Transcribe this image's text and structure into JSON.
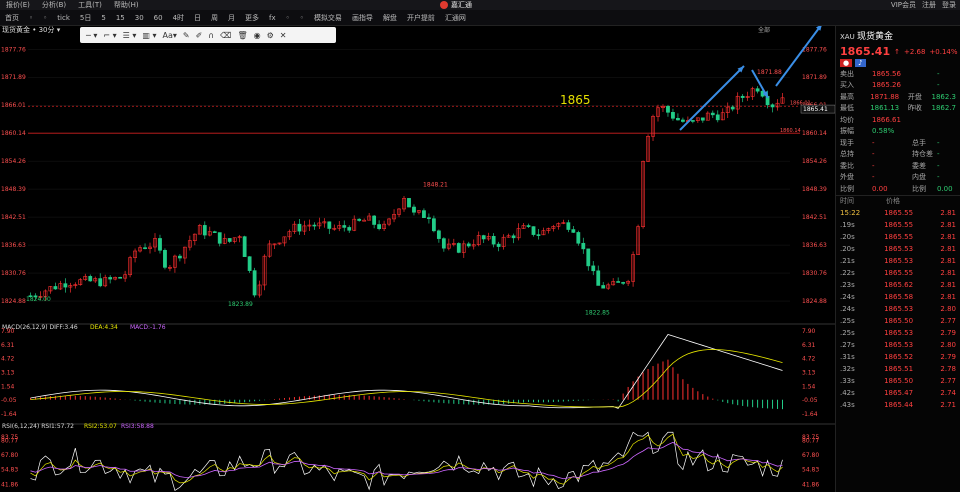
{
  "menu": {
    "items": [
      "报价(E)",
      "分析(B)",
      "工具(T)",
      "帮助(H)"
    ],
    "brand": "嘉汇通",
    "right": [
      "VIP会员",
      "注册",
      "登录"
    ]
  },
  "toolbar": {
    "items": [
      "首页",
      "",
      "",
      "tick",
      "5日",
      "5",
      "15",
      "30",
      "60",
      "4时",
      "日",
      "周",
      "月",
      "更多",
      "fx",
      "",
      "",
      "模拟交易",
      "画指导",
      "解盘",
      "开户提前",
      "汇通网"
    ]
  },
  "chart": {
    "title": "现货黄金 • 30分 ▾",
    "level_label": "1865",
    "restore_btn": "全部",
    "price_ticks": [
      1877.76,
      1871.89,
      1866.01,
      1860.14,
      1854.26,
      1848.39,
      1842.51,
      1836.63,
      1830.76,
      1824.88
    ],
    "price_range": [
      1820.9,
      1881.6
    ],
    "right_tags": [
      "1865.41",
      "1866.01",
      "1860.14",
      "1871.88"
    ],
    "annotations": [
      "1824.00",
      "1823.89",
      "1822.85",
      "1848.21",
      "1871.88"
    ],
    "macd": {
      "label": "MACD(26,12,9)",
      "diff": "DIFF:3.46",
      "dea": "DEA:4.34",
      "macd": "MACD:-1.76",
      "ticks": [
        "7.90",
        "6.31",
        "4.72",
        "3.13",
        "1.54",
        "-0.05",
        "-1.64"
      ]
    },
    "rsi": {
      "label": "RSI(6,12,24)",
      "r1": "RSI1:57.72",
      "r2": "RSI2:53.07",
      "r3": "RSI3:58.88",
      "ticks": [
        "83.75",
        "80.77",
        "67.80",
        "54.83",
        "41.86"
      ]
    },
    "colors": {
      "up": "#ff3030",
      "down": "#22cc88",
      "bg": "#000000",
      "line": "#d02020",
      "diff": "#ffffff",
      "dea": "#e6e600",
      "rsi3": "#cc66ff"
    }
  },
  "side": {
    "symbol_code": "XAU",
    "symbol_name": "现货黄金",
    "price": "1865.41",
    "arrow": "↑",
    "change": "+2.68",
    "pct": "+0.14%",
    "quotes": [
      {
        "l": "卖出",
        "v": "1865.56",
        "l2": "",
        "v2": "-"
      },
      {
        "l": "买入",
        "v": "1865.26",
        "l2": "",
        "v2": "-"
      },
      {
        "l": "最高",
        "v": "1871.88",
        "l2": "开盘",
        "v2": "1862.3"
      },
      {
        "l": "最低",
        "v": "1861.13",
        "l2": "昨收",
        "v2": "1862.7"
      },
      {
        "l": "均价",
        "v": "1866.61",
        "l2": "",
        "v2": ""
      },
      {
        "l": "振幅",
        "v": "0.58%",
        "l2": "",
        "v2": ""
      },
      {
        "l": "现手",
        "v": "-",
        "l2": "总手",
        "v2": "-"
      },
      {
        "l": "总持",
        "v": "-",
        "l2": "持仓差",
        "v2": "-"
      },
      {
        "l": "委比",
        "v": "-",
        "l2": "委差",
        "v2": "-"
      },
      {
        "l": "外盘",
        "v": "-",
        "l2": "内盘",
        "v2": "-"
      },
      {
        "l": "比例",
        "v": "0.00",
        "l2": "比例",
        "v2": "0.00"
      }
    ],
    "ticks_header": [
      "时间",
      "价格"
    ],
    "ticks": [
      {
        "t": "15:22",
        "p": "1865.55",
        "a": "2.81"
      },
      {
        "t": ".19s",
        "p": "1865.55",
        "a": "2.81"
      },
      {
        "t": ".20s",
        "p": "1865.55",
        "a": "2.81"
      },
      {
        "t": ".20s",
        "p": "1865.53",
        "a": "2.81"
      },
      {
        "t": ".21s",
        "p": "1865.53",
        "a": "2.81"
      },
      {
        "t": ".22s",
        "p": "1865.55",
        "a": "2.81"
      },
      {
        "t": ".23s",
        "p": "1865.62",
        "a": "2.81"
      },
      {
        "t": ".24s",
        "p": "1865.58",
        "a": "2.81"
      },
      {
        "t": ".24s",
        "p": "1865.53",
        "a": "2.80"
      },
      {
        "t": ".25s",
        "p": "1865.50",
        "a": "2.77"
      },
      {
        "t": ".25s",
        "p": "1865.53",
        "a": "2.79"
      },
      {
        "t": ".27s",
        "p": "1865.53",
        "a": "2.80"
      },
      {
        "t": ".31s",
        "p": "1865.52",
        "a": "2.79"
      },
      {
        "t": ".32s",
        "p": "1865.51",
        "a": "2.78"
      },
      {
        "t": ".33s",
        "p": "1865.50",
        "a": "2.77"
      },
      {
        "t": ".42s",
        "p": "1865.47",
        "a": "2.74"
      },
      {
        "t": ".43s",
        "p": "1865.44",
        "a": "2.71"
      }
    ]
  }
}
